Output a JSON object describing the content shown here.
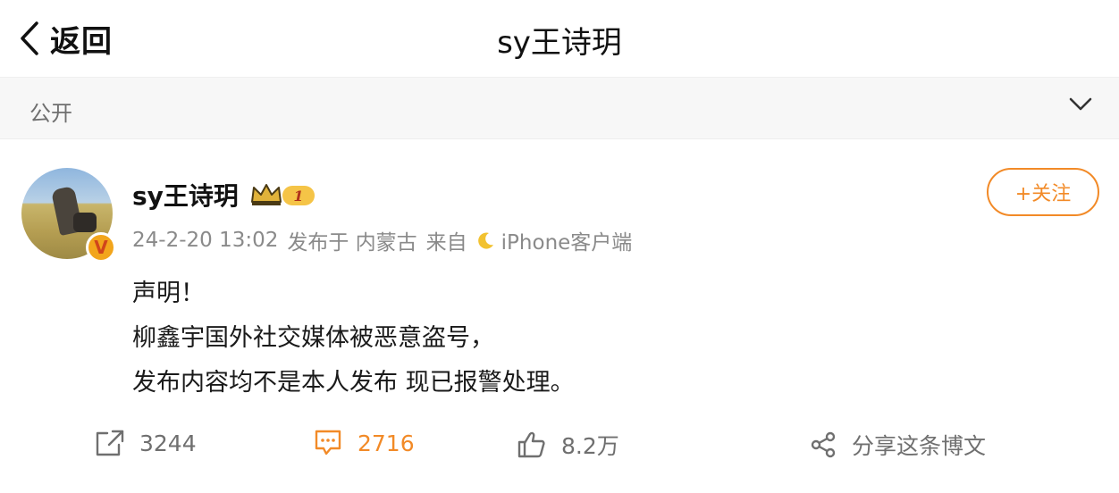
{
  "topbar": {
    "back_label": "返回",
    "title": "sy王诗玥"
  },
  "visibility": {
    "label": "公开"
  },
  "post": {
    "username": "sy王诗玥",
    "badge_level": "1",
    "verified_mark": "V",
    "meta": {
      "datetime": "24-2-20 13:02",
      "location": "发布于 内蒙古",
      "from_label": "来自",
      "client": "iPhone客户端"
    },
    "follow_label": "+关注",
    "content": [
      "声明！",
      "柳鑫宇国外社交媒体被恶意盗号，",
      "发布内容均不是本人发布 现已报警处理。"
    ],
    "actions": {
      "repost_count": "3244",
      "comment_count": "2716",
      "like_count": "8.2万",
      "share_label": "分享这条博文"
    }
  },
  "colors": {
    "accent": "#f28a27",
    "muted": "#8a8a8a",
    "badge": "#f2a51c"
  }
}
